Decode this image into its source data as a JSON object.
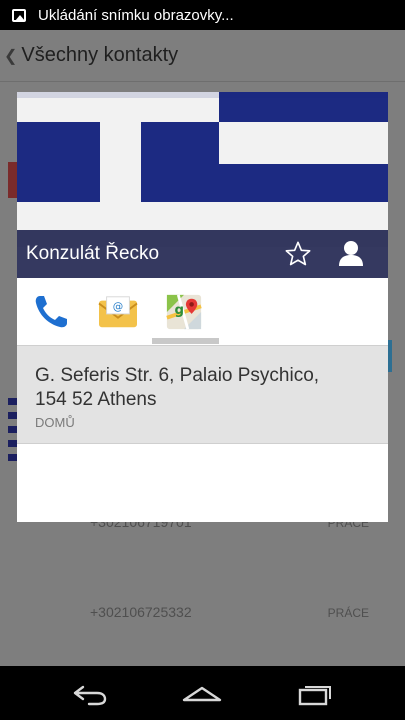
{
  "status_bar": {
    "icon": "screenshot-image-icon",
    "text": "Ukládání snímku obrazovky..."
  },
  "background_app": {
    "title": "Všechny kontakty",
    "rows": [
      {
        "number": "+302106719701",
        "kind": "PRÁCE"
      },
      {
        "number": "+302106725332",
        "kind": "PRÁCE"
      }
    ]
  },
  "quick_contact": {
    "name": "Konzulát Řecko",
    "icons": [
      "star-icon",
      "person-icon"
    ],
    "tabs": [
      {
        "name": "phone-icon"
      },
      {
        "name": "email-icon"
      },
      {
        "name": "maps-icon",
        "selected": true
      }
    ],
    "address": {
      "line1": "G. Seferis Str. 6, Palaio Psychico,",
      "line2": "154 52 Athens",
      "type": "DOMŮ"
    }
  },
  "nav_bar": {
    "icons": [
      "back-icon",
      "home-icon",
      "recent-apps-icon"
    ]
  },
  "colors": {
    "flag_blue": "#1c2a82",
    "dim_overlay": "#7e7e7e",
    "detail_background": "#e3e3e3"
  }
}
